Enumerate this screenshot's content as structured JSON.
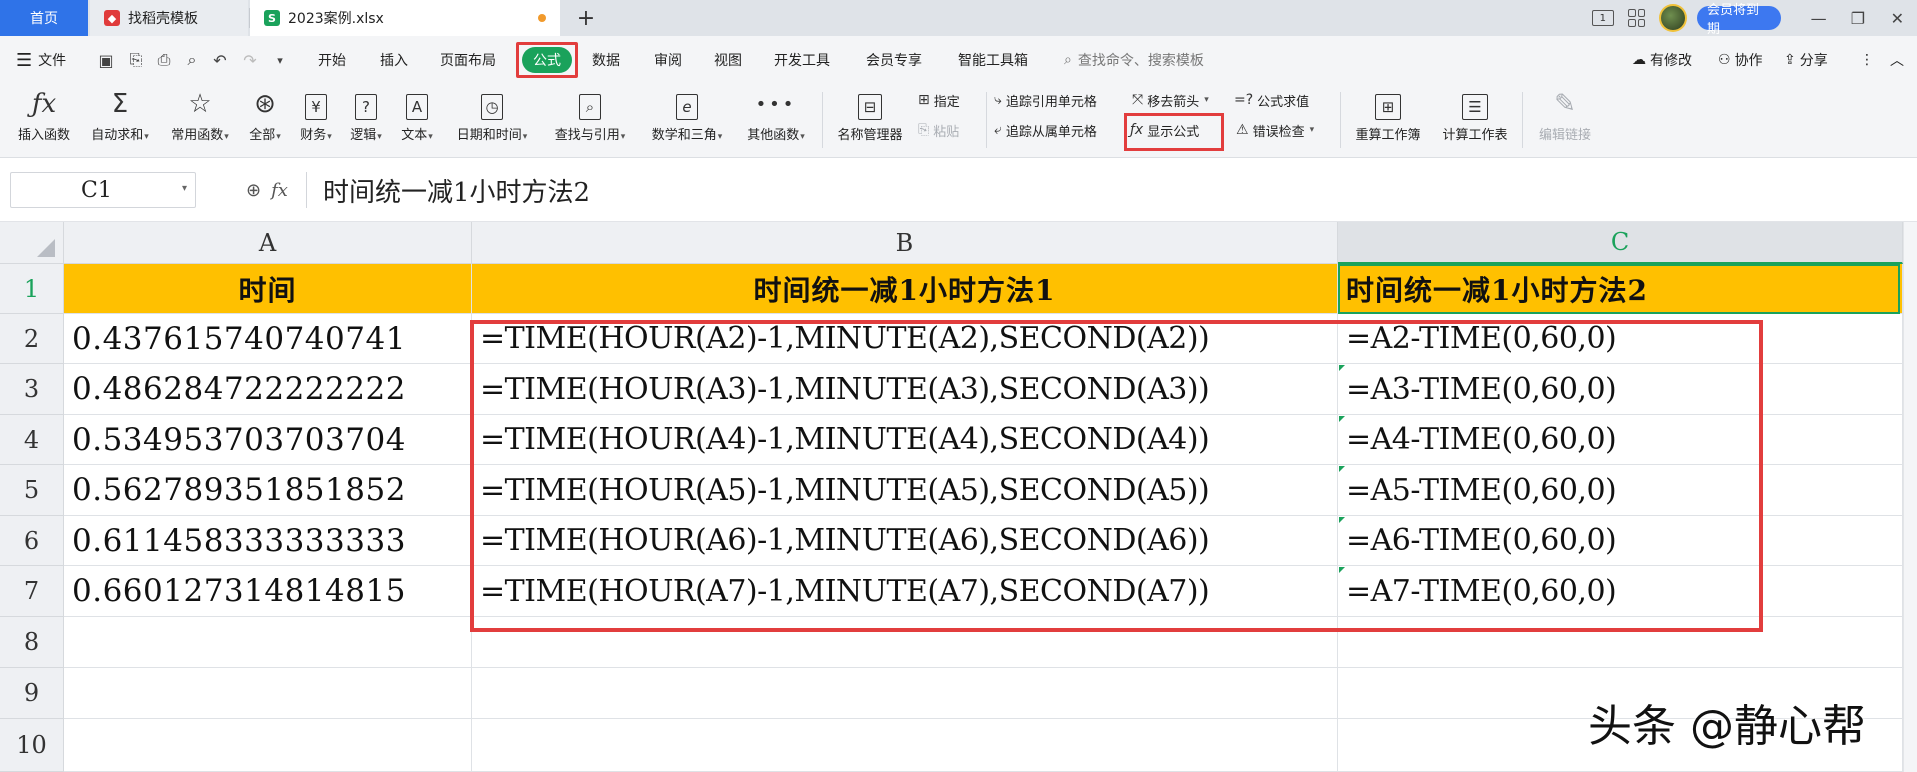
{
  "tabs": {
    "home": "首页",
    "docs": "找稻壳模板",
    "file": "2023案例.xlsx",
    "new_tab": "+"
  },
  "window": {
    "vip_label": "会员将到期",
    "minimize": "—",
    "restore": "❐",
    "close": "✕",
    "layout_badge": "1"
  },
  "menubar": {
    "file": "文件",
    "items": [
      "开始",
      "插入",
      "页面布局",
      "公式",
      "数据",
      "审阅",
      "视图",
      "开发工具",
      "会员专享",
      "智能工具箱"
    ],
    "active": "公式",
    "search_placeholder": "查找命令、搜索模板",
    "modified": "有修改",
    "collab": "协作",
    "share": "分享"
  },
  "ribbon": {
    "insert_func": "插入函数",
    "auto_sum": "自动求和",
    "common_func": "常用函数",
    "all": "全部",
    "finance": "财务",
    "logic": "逻辑",
    "text": "文本",
    "datetime": "日期和时间",
    "lookup": "查找与引用",
    "math": "数学和三角",
    "other_func": "其他函数",
    "name_mgr": "名称管理器",
    "assign": "指定",
    "paste": "粘贴",
    "trace_precedents": "追踪引用单元格",
    "trace_dependents": "追踪从属单元格",
    "remove_arrows": "移去箭头",
    "show_formulas": "显示公式",
    "eval_formula": "公式求值",
    "error_check": "错误检查",
    "recalc_book": "重算工作簿",
    "calc_sheet": "计算工作表",
    "edit_links": "编辑链接"
  },
  "formula_bar": {
    "cell_ref": "C1",
    "fx": "fx",
    "content": "时间统一减1小时方法2"
  },
  "sheet": {
    "columns": [
      "A",
      "B",
      "C"
    ],
    "active_column": "C",
    "rows": [
      "1",
      "2",
      "3",
      "4",
      "5",
      "6",
      "7",
      "8",
      "9",
      "10"
    ],
    "header": {
      "a": "时间",
      "b": "时间统一减1小时方法1",
      "c": "时间统一减1小时方法2"
    },
    "data": [
      {
        "a": "0.437615740740741",
        "b": "=TIME(HOUR(A2)-1,MINUTE(A2),SECOND(A2))",
        "c": "=A2-TIME(0,60,0)"
      },
      {
        "a": "0.486284722222222",
        "b": "=TIME(HOUR(A3)-1,MINUTE(A3),SECOND(A3))",
        "c": "=A3-TIME(0,60,0)"
      },
      {
        "a": "0.534953703703704",
        "b": "=TIME(HOUR(A4)-1,MINUTE(A4),SECOND(A4))",
        "c": "=A4-TIME(0,60,0)"
      },
      {
        "a": "0.562789351851852",
        "b": "=TIME(HOUR(A5)-1,MINUTE(A5),SECOND(A5))",
        "c": "=A5-TIME(0,60,0)"
      },
      {
        "a": "0.611458333333333",
        "b": "=TIME(HOUR(A6)-1,MINUTE(A6),SECOND(A6))",
        "c": "=A6-TIME(0,60,0)"
      },
      {
        "a": "0.660127314814815",
        "b": "=TIME(HOUR(A7)-1,MINUTE(A7),SECOND(A7))",
        "c": "=A7-TIME(0,60,0)"
      }
    ]
  },
  "watermark": "头条 @静心帮",
  "colors": {
    "accent_green": "#1aa25b",
    "highlight_red": "#e23d3d",
    "header_fill": "#ffc000",
    "home_tab_blue": "#2f73e8"
  }
}
